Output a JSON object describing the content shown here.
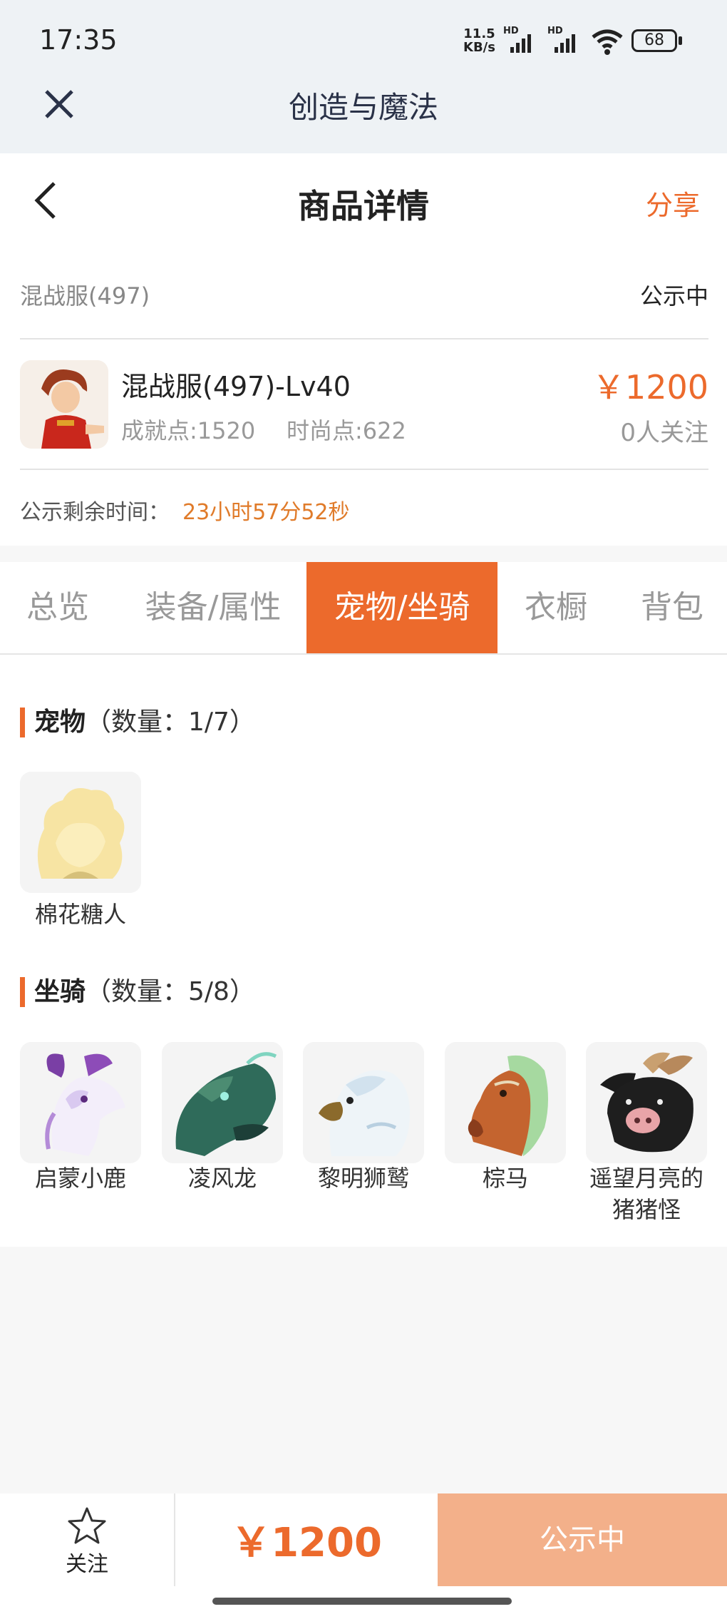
{
  "status": {
    "time": "17:35",
    "speed_top": "11.5",
    "speed_bottom": "KB/s",
    "hd1": "HD",
    "hd2": "HD",
    "battery": "68"
  },
  "titlebar": {
    "title": "创造与魔法"
  },
  "header": {
    "title": "商品详情",
    "share": "分享"
  },
  "product": {
    "server": "混战服(497)",
    "status": "公示中",
    "name": "混战服(497)-Lv40",
    "achievement": "成就点:1520",
    "fashion": "时尚点:622",
    "price": "￥1200",
    "followers": "0人关注",
    "remaining_label": "公示剩余时间：",
    "remaining_value": "23小时57分52秒"
  },
  "tabs": [
    "总览",
    "装备/属性",
    "宠物/坐骑",
    "衣橱",
    "背包"
  ],
  "active_tab": "宠物/坐骑",
  "pets": {
    "title": "宠物",
    "count": "（数量：1/7）",
    "items": [
      {
        "name": "棉花糖人",
        "icon": "cotton-candy-pet-icon"
      }
    ]
  },
  "mounts": {
    "title": "坐骑",
    "count": "（数量：5/8）",
    "items": [
      {
        "name": "启蒙小鹿",
        "icon": "white-deer-mount-icon"
      },
      {
        "name": "凌风龙",
        "icon": "green-dragon-mount-icon"
      },
      {
        "name": "黎明狮鹫",
        "icon": "griffin-mount-icon"
      },
      {
        "name": "棕马",
        "icon": "brown-horse-mount-icon"
      },
      {
        "name": "遥望月亮的猪猪怪",
        "icon": "black-pig-mount-icon",
        "name_line1": "遥望月亮的",
        "name_line2": "猪猪怪"
      }
    ]
  },
  "bottom": {
    "follow": "关注",
    "price": "￥1200",
    "action": "公示中"
  },
  "colors": {
    "accent": "#ec6a2c",
    "action_bg": "#f3b08a"
  }
}
